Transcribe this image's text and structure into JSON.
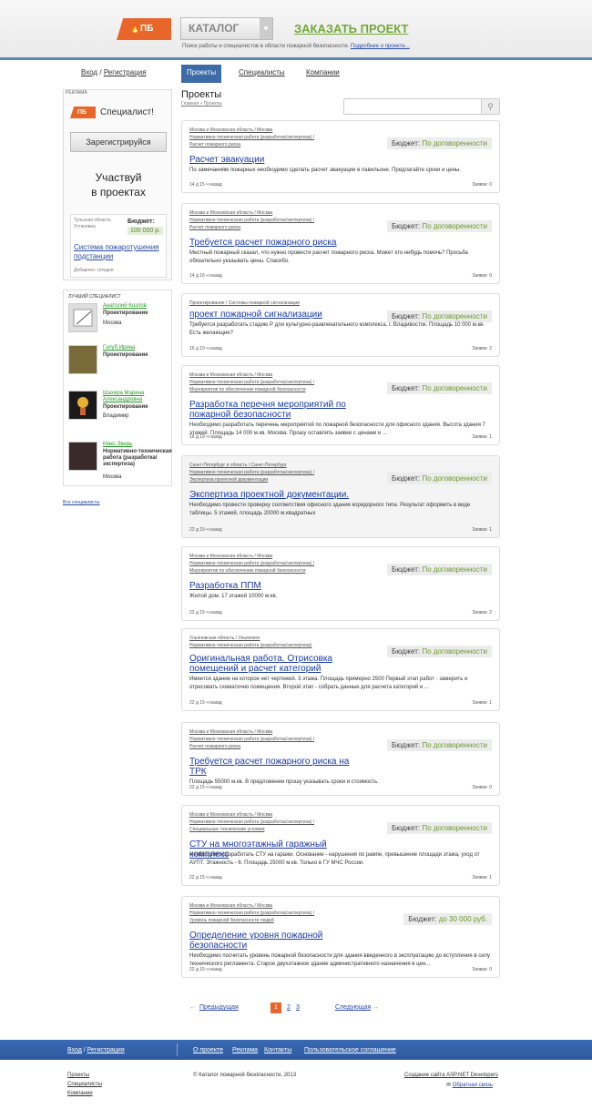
{
  "header": {
    "logo": "ПБ",
    "catalog": "КАТАЛОГ",
    "order": "ЗАКАЗАТЬ ПРОЕКТ",
    "tagline": "Поиск работы и специалистов в области пожарной безопасности.",
    "tagline_link": "Подробнее о проекте..."
  },
  "nav": {
    "login": "Вход",
    "sep": "/",
    "register": "Регистрация",
    "tabs": [
      "Проекты",
      "Специалисты",
      "Компании"
    ]
  },
  "ad": {
    "label": "РЕКЛАМА",
    "logo": "ПБ",
    "title": "Специалист!",
    "button": "Зарегистрируйся",
    "line1": "Участвуй",
    "line2": "в проектах",
    "mini": {
      "loc1": "Тульская область",
      "loc2": "Установка",
      "budget_label": "Бюджет:",
      "budget_value": "100 000 р.",
      "title": "Система пожаротушения подстанции",
      "added": "Добавлен: сегодня"
    }
  },
  "best": {
    "label": "ЛУЧШИЙ СПЕЦИАЛИСТ",
    "specialists": [
      {
        "name": "Анатолий Козлов",
        "field": "Проектирование",
        "city": "Москва"
      },
      {
        "name": "Голуб Ирина",
        "field": "Проектирование",
        "city": ""
      },
      {
        "name": "Шахира Марина Александровна",
        "field": "Проектирование",
        "city": "Владимир"
      },
      {
        "name": "Макс Зверь",
        "field": "Нормативно-техническая работа (разработка/экспертиза)",
        "city": "Москва"
      }
    ],
    "all": "Все специалисты"
  },
  "main": {
    "title": "Проекты",
    "breadcrumb": "Главная » Проекты"
  },
  "projects": [
    {
      "cat1": "Москва и Московская область / Москва",
      "cat2": "Нормативно-техническая работа (разработка/экспертиза) /",
      "cat3": "Расчет пожарного риска",
      "budget_label": "Бюджет:",
      "budget": "По договоренности",
      "title": "Расчет эвакуации",
      "desc": "По замечаниям пожарных необходимо сделать расчет эвакуации в павильоне. Предлагайте сроки и цены.",
      "time": "14 д 15 ч назад",
      "apps": "Заявок: 0"
    },
    {
      "cat1": "Москва и Московская область / Москва",
      "cat2": "Нормативно-техническая работа (разработка/экспертиза) /",
      "cat3": "Расчет пожарного риска",
      "budget_label": "Бюджет:",
      "budget": "По договоренности",
      "title": "Требуется расчет пожарного риска",
      "desc": "Местный пожарный сказал, что нужно провести расчет пожарного риска. Может кто нибудь помочь? Просьба обязательно указывать цены. Спасибо.",
      "time": "14 д 16 ч назад",
      "apps": "Заявок: 0"
    },
    {
      "cat1": "Проектирование / Системы пожарной сигнализации",
      "cat2": "",
      "cat3": "",
      "budget_label": "Бюджет:",
      "budget": "По договоренности",
      "title": "проект пожарной сигнализации",
      "desc": "Требуется разработать стадию Р для культурно-развлекательного комплекса. г. Владивосток. Площадь 10 000 м.кв. Есть желающие?",
      "time": "16 д 19 ч назад",
      "apps": "Заявок: 2"
    },
    {
      "cat1": "Москва и Московская область / Москва",
      "cat2": "Нормативно-техническая работа (разработка/экспертиза) /",
      "cat3": "Мероприятия по обеспечению пожарной безопасности",
      "budget_label": "Бюджет:",
      "budget": "По договоренности",
      "title": "Разработка перечня мероприятий по пожарной безопасности",
      "desc": "Необходимо разработать перечень мероприятий по пожарной безопасности для офисного здания. Высота здания 7 этажей. Площадь 14 000 м.кв. Москва. Прошу оставлять заявки с ценами и ...",
      "time": "16 д 19 ч назад",
      "apps": "Заявок: 1"
    },
    {
      "cat1": "Санкт-Петербург и область / Санкт-Петербург",
      "cat2": "Нормативно-техническая работа (разработка/экспертиза) /",
      "cat3": "Экспертиза проектной документации",
      "budget_label": "Бюджет:",
      "budget": "По договоренности",
      "title": "Экспертиза проектной документации.",
      "desc": "Необходимо провести проверку соответствия офисного здания коридорного типа. Результат оформить в виде таблицы. 5 этажей, площадь 20000 м.квадратных",
      "time": "22 д 15 ч назад",
      "apps": "Заявок: 1"
    },
    {
      "cat1": "Москва и Московская область / Москва",
      "cat2": "Нормативно-техническая работа (разработка/экспертиза) /",
      "cat3": "Мероприятия по обеспечению пожарной безопасности",
      "budget_label": "Бюджет:",
      "budget": "По договоренности",
      "title": "Разработка ППМ",
      "desc": "Жилой дом. 17 этажей 10000 м.кв.",
      "time": "22 д 15 ч назад",
      "apps": "Заявок: 2"
    },
    {
      "cat1": "Ульяновская область / Ульяновск",
      "cat2": "Нормативно-техническая работа (разработка/экспертиза)",
      "cat3": "",
      "budget_label": "Бюджет:",
      "budget": "По договоренности",
      "title": "Оригинальная работа. Отрисовка помещений и расчет категорий",
      "desc": "Имеется здание на которое нет чертежей. 3 этажа. Площадь примерно 2500 Первый этап работ - замерить и отрисовать схематично помещения. Второй этап - собрать данные для расчета категорий и ...",
      "time": "22 д 15 ч назад",
      "apps": "Заявок: 1"
    },
    {
      "cat1": "Москва и Московская область / Москва",
      "cat2": "Нормативно-техническая работа (разработка/экспертиза) /",
      "cat3": "Расчет пожарного риска",
      "budget_label": "Бюджет:",
      "budget": "По договоренности",
      "title": "Требуется расчет пожарного риска на ТРК",
      "desc": "Площадь 55000 м.кв. В предложении прошу указывать сроки и стоимость.",
      "time": "22 д 15 ч назад",
      "apps": "Заявок: 0"
    },
    {
      "cat1": "Москва и Московская область / Москва",
      "cat2": "Нормативно-техническая работа (разработка/экспертиза) /",
      "cat3": "Специальные технические условия",
      "budget_label": "Бюджет:",
      "budget": "По договоренности",
      "title": "СТУ на многоэтажный гаражный комплекс",
      "desc": "Необходимо разработать СТУ на гаражи. Основание - нарушения по рампе, превышение площади этажа, уход от АУПТ. Этажность - 6. Площадь 25000 м.кв. Только в ГУ МЧС России.",
      "time": "22 д 15 ч назад",
      "apps": "Заявок: 1"
    },
    {
      "cat1": "Москва и Московская область / Москва",
      "cat2": "Нормативно-техническая работа (разработка/экспертиза) /",
      "cat3": "Уровень пожарной безопасности людей",
      "budget_label": "Бюджет:",
      "budget": "до 30 000 руб.",
      "title": "Определение уровня пожарной безопасности",
      "desc": "Необходимо посчитать уровень пожарной безопасности для здания введенного в эксплуатацию до вступления в силу технического регламента. Старое двухэтажное здание административного назначения в цен...",
      "time": "22 д 15 ч назад",
      "apps": "Заявок: 0"
    }
  ],
  "pager": {
    "prev": "Предыдущая",
    "next": "Следующая",
    "pages": [
      "1",
      "2",
      "3"
    ],
    "prev_arrow": "←",
    "next_arrow": "→"
  },
  "footer": {
    "login": "Вход",
    "register": "Регистрация",
    "links": [
      "О проекте",
      "Реклама",
      "Контакты",
      "Пользовательское соглашение"
    ],
    "bottom_links": [
      "Проекты",
      "Специалисты",
      "Компании"
    ],
    "copyright": "© Каталог пожарной безопасности, 2013",
    "dev": "Создание сайта ASP.NET Developers",
    "feedback": "Обратная связь"
  },
  "colors": {
    "accent": "#e8662a",
    "blue": "#3d6ba8",
    "green": "#73a838"
  }
}
